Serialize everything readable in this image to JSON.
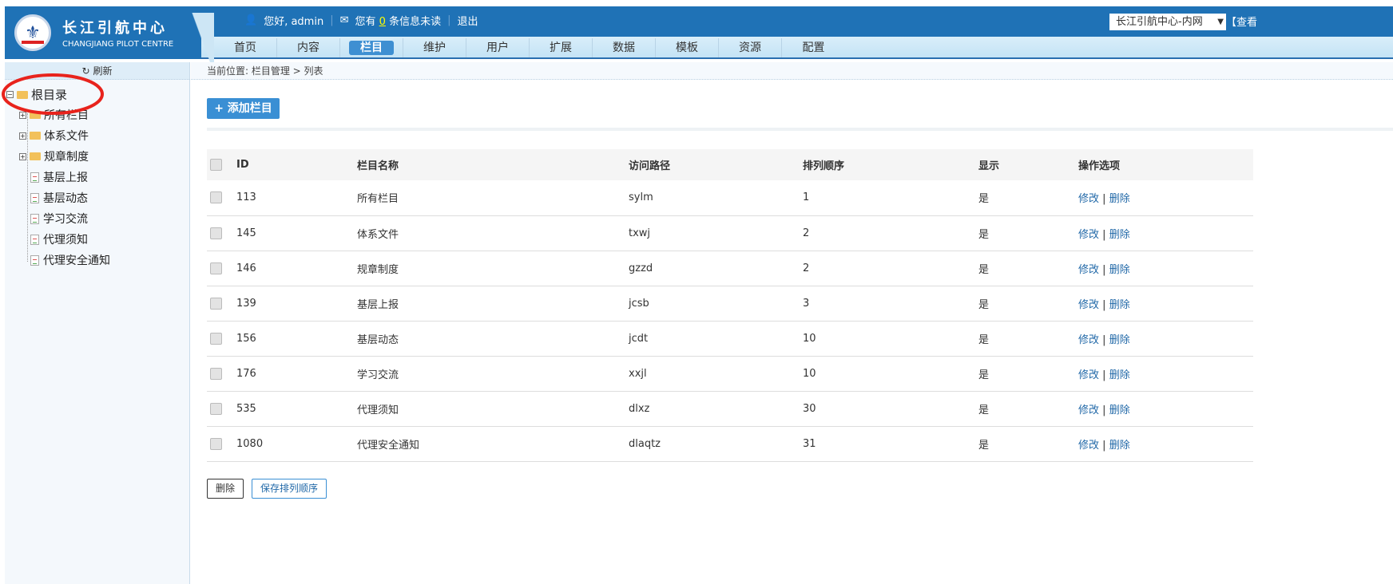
{
  "header": {
    "logo_cn": "长江引航中心",
    "logo_en": "CHANGJIANG PILOT CENTRE",
    "greeting": "您好, admin",
    "msg_prefix": "您有",
    "msg_count": "0",
    "msg_suffix": "条信息未读",
    "logout": "退出",
    "site_select": "长江引航中心-内网",
    "view_link": "【查看"
  },
  "nav": [
    "首页",
    "内容",
    "栏目",
    "维护",
    "用户",
    "扩展",
    "数据",
    "模板",
    "资源",
    "配置"
  ],
  "nav_active": 2,
  "sidebar": {
    "refresh": "刷新",
    "root": "根目录",
    "items": [
      "所有栏目",
      "体系文件",
      "规章制度",
      "基层上报",
      "基层动态",
      "学习交流",
      "代理须知",
      "代理安全通知"
    ]
  },
  "breadcrumb": "当前位置: 栏目管理 > 列表",
  "add_button": "+ 添加栏目",
  "table": {
    "headers": [
      "ID",
      "栏目名称",
      "访问路径",
      "排列顺序",
      "显示",
      "操作选项"
    ],
    "rows": [
      {
        "id": "113",
        "name": "所有栏目",
        "path": "sylm",
        "order": "1",
        "show": "是"
      },
      {
        "id": "145",
        "name": "体系文件",
        "path": "txwj",
        "order": "2",
        "show": "是"
      },
      {
        "id": "146",
        "name": "规章制度",
        "path": "gzzd",
        "order": "2",
        "show": "是"
      },
      {
        "id": "139",
        "name": "基层上报",
        "path": "jcsb",
        "order": "3",
        "show": "是"
      },
      {
        "id": "156",
        "name": "基层动态",
        "path": "jcdt",
        "order": "10",
        "show": "是"
      },
      {
        "id": "176",
        "name": "学习交流",
        "path": "xxjl",
        "order": "10",
        "show": "是"
      },
      {
        "id": "535",
        "name": "代理须知",
        "path": "dlxz",
        "order": "30",
        "show": "是"
      },
      {
        "id": "1080",
        "name": "代理安全通知",
        "path": "dlaqtz",
        "order": "31",
        "show": "是"
      }
    ],
    "edit": "修改",
    "sep": "|",
    "delete": "删除"
  },
  "footer": {
    "delete": "删除",
    "save_order": "保存排列顺序"
  },
  "colors": {
    "topbar": "#1f72b6",
    "accent": "#3a8fd4",
    "annotation": "#e8231c"
  }
}
